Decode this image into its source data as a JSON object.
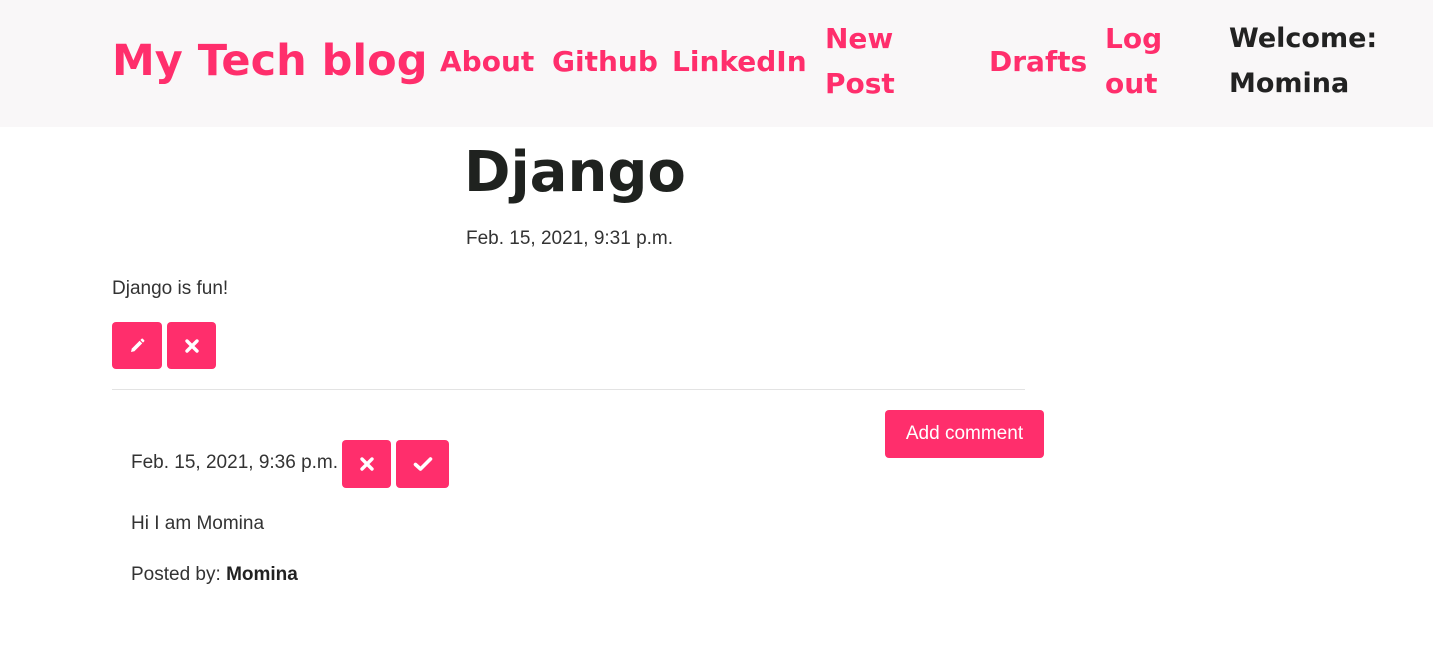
{
  "header": {
    "brand": "My Tech blog",
    "nav": {
      "about": "About",
      "github": "Github",
      "linkedin": "LinkedIn",
      "new_post": "New Post",
      "drafts": "Drafts",
      "logout": "Log out"
    },
    "welcome": "Welcome: Momina"
  },
  "post": {
    "title": "Django",
    "date": "Feb. 15, 2021, 9:31 p.m.",
    "body": "Django is fun!",
    "actions": {
      "edit_icon": "pencil-icon",
      "delete_icon": "times-icon"
    }
  },
  "comments": {
    "add_label": "Add comment",
    "items": [
      {
        "date": "Feb. 15, 2021, 9:36 p.m.",
        "text": "Hi I am Momina",
        "posted_by_label": "Posted by:",
        "author": "Momina",
        "actions": {
          "remove_icon": "times-icon",
          "approve_icon": "check-icon"
        }
      }
    ]
  },
  "colors": {
    "accent": "#ff2e6c",
    "header_bg": "#f9f7f8",
    "heading": "#1f221f",
    "text": "#333333"
  }
}
